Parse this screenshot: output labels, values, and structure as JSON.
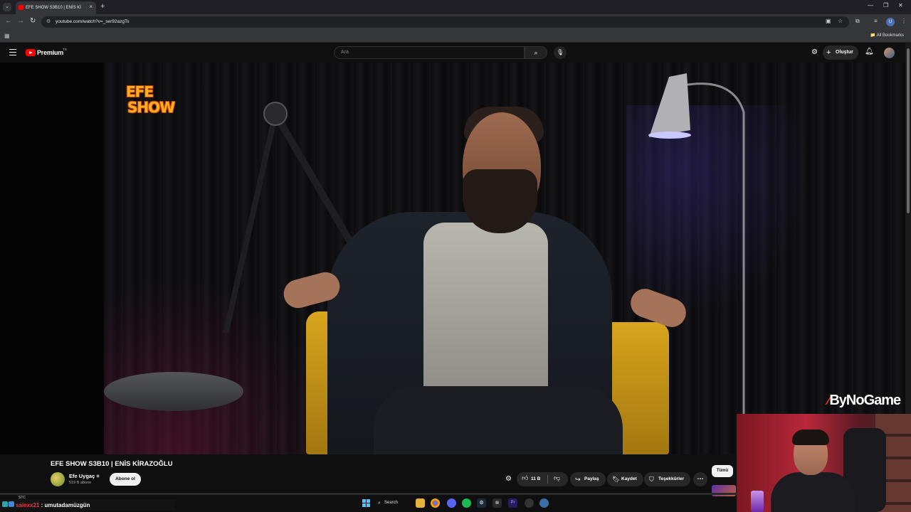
{
  "browser": {
    "tab_title": "EFE SHOW S3B10 | ENİS Kİ",
    "new_tab_label": "+",
    "url": "youtube.com/watch?v=_ser92azgTs",
    "all_bookmarks": "All Bookmarks",
    "profile_initial": "U"
  },
  "youtube": {
    "logo_text": "Premium",
    "country_code": "TR",
    "search_placeholder": "Ara",
    "create_label": "Oluştur"
  },
  "video": {
    "show_logo_line1": "EFE",
    "show_logo_line2": "SHOW",
    "sponsor_watermark": "ByNoGame",
    "title": "EFE SHOW S3B10 | ENİS KİRAZOĞLU",
    "channel_name": "Efe Uygaç",
    "subscriber_count": "519 B abone",
    "subscribe_label": "Abone ol",
    "like_count": "11 B",
    "share_label": "Paylaş",
    "save_label": "Kaydet",
    "thanks_label": "Teşekkürler",
    "filter_chip": "Tümü",
    "progress": 0.0
  },
  "chat_overlay": {
    "tag": "STC",
    "user": "saiexx21",
    "message": ": umutadamüzgün"
  },
  "taskbar": {
    "search_label": "Search"
  },
  "colors": {
    "youtube_red": "#ff0000",
    "background": "#0f0f0f",
    "chip_bg": "#272727"
  }
}
